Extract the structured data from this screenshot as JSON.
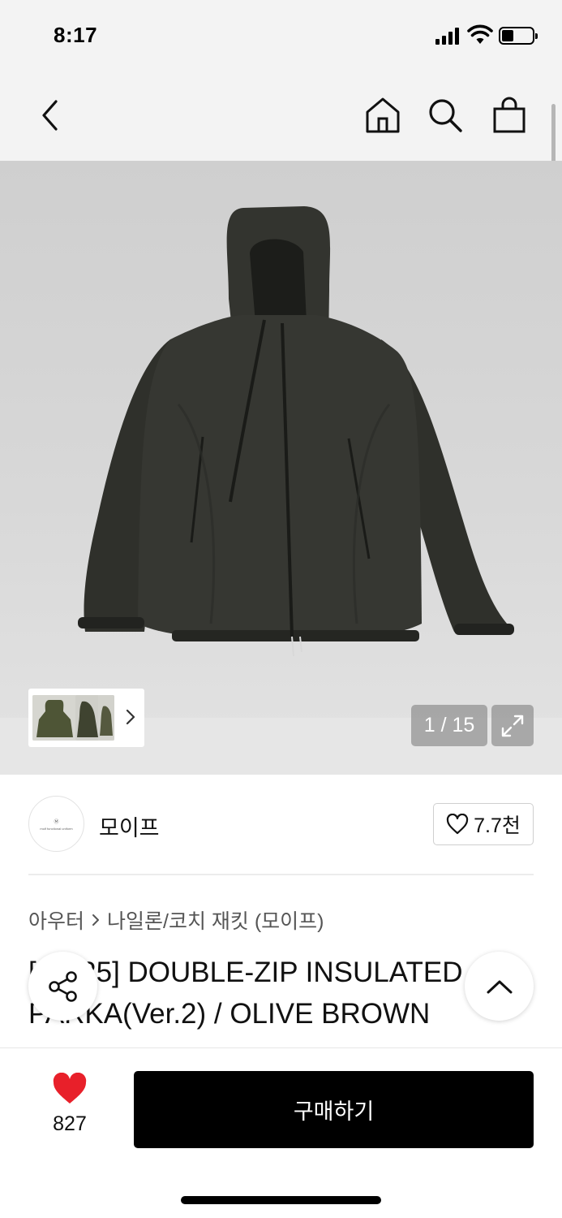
{
  "status_bar": {
    "time": "8:17",
    "battery_level": 0.4
  },
  "nav": {
    "icons": [
      "back-arrow-icon",
      "home-icon",
      "search-icon",
      "shopping-bag-icon"
    ]
  },
  "gallery": {
    "counter": "1 / 15",
    "current": 1,
    "total": 15,
    "icons": [
      "expand-icon",
      "chevron-right-icon"
    ]
  },
  "brand": {
    "logo_mark": "Ⓜ",
    "logo_tag": "moif functional uniform",
    "name": "모이프",
    "like_count": "7.7천"
  },
  "breadcrumb": {
    "category": "아우터",
    "subcategory": "나일론/코치 재킷 (모이프)"
  },
  "product": {
    "title": "[FW25] DOUBLE-ZIP INSULATED PARKA(Ver.2) / OLIVE BROWN"
  },
  "bottom_bar": {
    "like_count": "827",
    "buy_label": "구매하기"
  },
  "colors": {
    "accent": "#000000",
    "heart": "#e8202a",
    "jacket": "#343530"
  }
}
